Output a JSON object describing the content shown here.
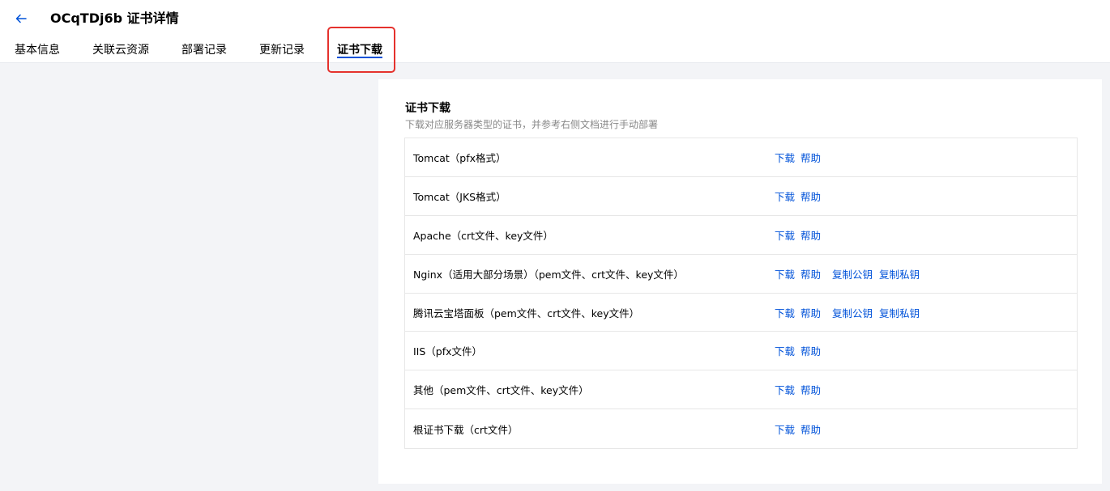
{
  "header": {
    "title": "OCqTDj6b 证书详情",
    "back_icon": "arrow-left-icon"
  },
  "tabs": [
    {
      "label": "基本信息",
      "active": false
    },
    {
      "label": "关联云资源",
      "active": false
    },
    {
      "label": "部署记录",
      "active": false
    },
    {
      "label": "更新记录",
      "active": false
    },
    {
      "label": "证书下载",
      "active": true
    }
  ],
  "colors": {
    "accent": "#0052d9",
    "highlight": "#e5322d",
    "background": "#f3f4f7"
  },
  "download": {
    "title": "证书下载",
    "description": "下载对应服务器类型的证书，并参考右侧文档进行手动部署",
    "rows": [
      {
        "label": "Tomcat（pfx格式）",
        "actions": [
          "下载",
          "帮助"
        ]
      },
      {
        "label": "Tomcat（JKS格式）",
        "actions": [
          "下载",
          "帮助"
        ]
      },
      {
        "label": "Apache（crt文件、key文件）",
        "actions": [
          "下载",
          "帮助"
        ]
      },
      {
        "label": "Nginx（适用大部分场景）（pem文件、crt文件、key文件）",
        "actions": [
          "下载",
          "帮助",
          "复制公钥",
          "复制私钥"
        ]
      },
      {
        "label": "腾讯云宝塔面板（pem文件、crt文件、key文件）",
        "actions": [
          "下载",
          "帮助",
          "复制公钥",
          "复制私钥"
        ]
      },
      {
        "label": "IIS（pfx文件）",
        "actions": [
          "下载",
          "帮助"
        ]
      },
      {
        "label": "其他（pem文件、crt文件、key文件）",
        "actions": [
          "下载",
          "帮助"
        ]
      },
      {
        "label": "根证书下载（crt文件）",
        "actions": [
          "下载",
          "帮助"
        ]
      }
    ]
  }
}
